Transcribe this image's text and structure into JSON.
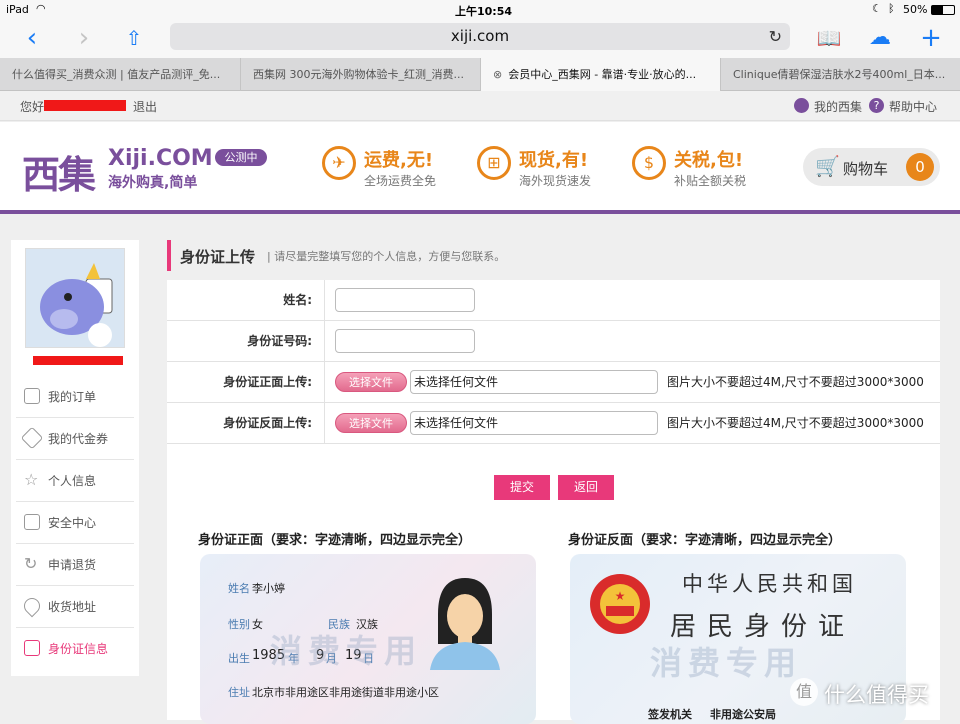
{
  "status_bar": {
    "device": "iPad",
    "time": "上午10:54",
    "battery": "50%"
  },
  "browser": {
    "address": "xiji.com",
    "tabs": [
      {
        "label": "什么值得买_消费众测 | 值友产品测评_免..."
      },
      {
        "label": "西集网 300元海外购物体验卡_红测_消费..."
      },
      {
        "label": "会员中心_西集网 - 靠谱·专业·放心的..."
      },
      {
        "label": "Clinique倩碧保湿洁肤水2号400ml_日本..."
      }
    ]
  },
  "topbar": {
    "greeting": "您好",
    "logout": "退出",
    "my_account": "我的西集",
    "help": "帮助中心"
  },
  "header": {
    "logo_cn": "西集",
    "logo_en": "Xiji.COM",
    "tagline": "海外购真,简单",
    "beta_badge": "公测中",
    "features": [
      {
        "title": "运费,无!",
        "sub": "全场运费全免",
        "icon": "plane-icon"
      },
      {
        "title": "现货,有!",
        "sub": "海外现货速发",
        "icon": "gift-icon"
      },
      {
        "title": "关税,包!",
        "sub": "补贴全额关税",
        "icon": "coin-icon"
      }
    ],
    "cart_label": "购物车",
    "cart_count": "0"
  },
  "sidebar": {
    "items": [
      {
        "label": "我的订单",
        "icon": "order-icon"
      },
      {
        "label": "我的代金券",
        "icon": "coupon-icon"
      },
      {
        "label": "个人信息",
        "icon": "star-icon"
      },
      {
        "label": "安全中心",
        "icon": "edit-icon"
      },
      {
        "label": "申请退货",
        "icon": "refresh-icon"
      },
      {
        "label": "收货地址",
        "icon": "location-icon"
      },
      {
        "label": "身份证信息",
        "icon": "id-icon"
      }
    ]
  },
  "form": {
    "title": "身份证上传",
    "subtitle": "| 请尽量完整填写您的个人信息，方便与您联系。",
    "name_label": "姓名:",
    "id_label": "身份证号码:",
    "front_label": "身份证正面上传:",
    "back_label": "身份证反面上传:",
    "choose_file": "选择文件",
    "no_file": "未选择任何文件",
    "hint": "图片大小不要超过4M,尺寸不要超过3000*3000",
    "submit": "提交",
    "back": "返回"
  },
  "cards": {
    "front_title": "身份证正面（要求：字迹清晰，四边显示完全）",
    "back_title": "身份证反面（要求：字迹清晰，四边显示完全）",
    "front": {
      "name_label": "姓名",
      "name": "李小婷",
      "sex_label": "性别",
      "sex": "女",
      "ethnic_label": "民族",
      "ethnic": "汉族",
      "birth_label": "出生",
      "year": "1985",
      "year_unit": "年",
      "month": "9",
      "month_unit": "月",
      "day": "19",
      "day_unit": "日",
      "addr_label": "住址",
      "addr": "北京市非用途区非用途街道非用途小区",
      "watermark": "消费专用"
    },
    "back": {
      "country": "中华人民共和国",
      "doc": "居民身份证",
      "issuer_label": "签发机关",
      "issuer": "非用途公安局",
      "watermark": "消费专用"
    }
  },
  "watermark_site": "什么值得买",
  "colors": {
    "purple": "#7a4f9c",
    "orange": "#e8861a",
    "pink": "#e8397a"
  }
}
